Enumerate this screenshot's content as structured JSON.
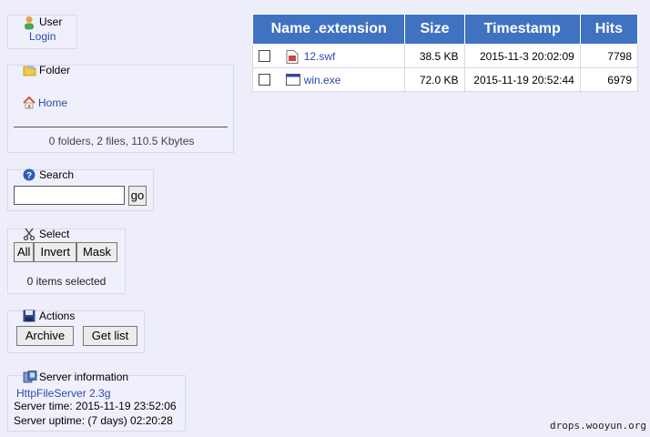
{
  "user": {
    "title": "User",
    "login": "Login"
  },
  "folder": {
    "title": "Folder",
    "home": "Home",
    "summary": "0 folders, 2 files, 110.5 Kbytes"
  },
  "search": {
    "title": "Search",
    "input_value": "",
    "go": "go"
  },
  "select": {
    "title": "Select",
    "all": "All",
    "invert": "Invert",
    "mask": "Mask",
    "status": "0 items selected"
  },
  "actions": {
    "title": "Actions",
    "archive": "Archive",
    "get_list": "Get list"
  },
  "server": {
    "title": "Server information",
    "software": "HttpFileServer 2.3g",
    "time": "Server time: 2015-11-19 23:52:06",
    "uptime": "Server uptime: (7 days) 02:20:28"
  },
  "table": {
    "headers": [
      "Name .extension",
      "Size",
      "Timestamp",
      "Hits"
    ],
    "rows": [
      {
        "name": "12.swf",
        "size": "38.5 KB",
        "timestamp": "2015-11-3 20:02:09",
        "hits": "7798",
        "icon": "swf-file-icon"
      },
      {
        "name": "win.exe",
        "size": "72.0 KB",
        "timestamp": "2015-11-19 20:52:44",
        "hits": "6979",
        "icon": "exe-file-icon"
      }
    ]
  },
  "watermark": "drops.wooyun.org"
}
